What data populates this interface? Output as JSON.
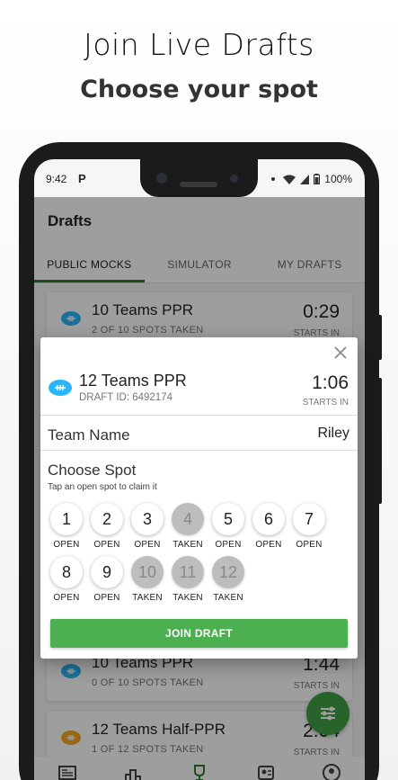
{
  "promo": {
    "headline": "Join Live Drafts",
    "subheadline": "Choose your spot"
  },
  "status": {
    "time": "9:42",
    "app_letter": "P",
    "battery": "100%"
  },
  "appbar": {
    "title": "Drafts"
  },
  "tabs": [
    {
      "label": "PUBLIC MOCKS",
      "active": true
    },
    {
      "label": "SIMULATOR",
      "active": false
    },
    {
      "label": "MY DRAFTS",
      "active": false
    }
  ],
  "list": [
    {
      "title": "10 Teams PPR",
      "subtitle": "2 OF 10 SPOTS TAKEN",
      "time": "0:29",
      "starts": "STARTS IN"
    },
    {
      "title": "10 Teams PPR",
      "subtitle": "0 OF 10 SPOTS TAKEN",
      "time": "1:44",
      "starts": "STARTS IN"
    },
    {
      "title": "12 Teams Half-PPR",
      "subtitle": "1 OF 12 SPOTS TAKEN",
      "time": "2:04",
      "starts": "STARTS IN"
    }
  ],
  "dialog": {
    "title": "12 Teams PPR",
    "draft_id": "DRAFT ID: 6492174",
    "time": "1:06",
    "starts": "STARTS IN",
    "team_name_label": "Team Name",
    "team_name_value": "Riley",
    "choose_spot_label": "Choose Spot",
    "choose_spot_hint": "Tap an open spot to claim it",
    "spots": [
      {
        "number": "1",
        "status": "OPEN"
      },
      {
        "number": "2",
        "status": "OPEN"
      },
      {
        "number": "3",
        "status": "OPEN"
      },
      {
        "number": "4",
        "status": "TAKEN"
      },
      {
        "number": "5",
        "status": "OPEN"
      },
      {
        "number": "6",
        "status": "OPEN"
      },
      {
        "number": "7",
        "status": "OPEN"
      },
      {
        "number": "8",
        "status": "OPEN"
      },
      {
        "number": "9",
        "status": "OPEN"
      },
      {
        "number": "10",
        "status": "TAKEN"
      },
      {
        "number": "11",
        "status": "TAKEN"
      },
      {
        "number": "12",
        "status": "TAKEN"
      }
    ],
    "join_label": "JOIN DRAFT"
  },
  "colors": {
    "accent_green": "#4caf50",
    "tab_indicator": "#2e7d32",
    "football_blue": "#29b6f6",
    "football_orange": "#f5a623"
  },
  "icons": [
    "close-icon",
    "football-icon",
    "filter-icon",
    "news-icon",
    "rankings-icon",
    "trophy-icon",
    "player-card-icon",
    "profile-icon"
  ]
}
